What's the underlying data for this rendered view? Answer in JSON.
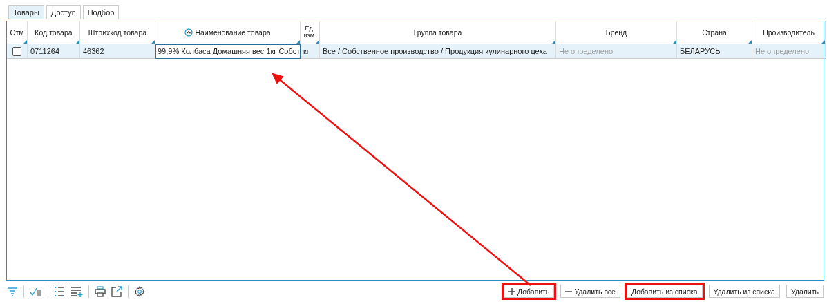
{
  "tabs": [
    {
      "label": "Товары",
      "selected": true
    },
    {
      "label": "Доступ",
      "selected": false
    },
    {
      "label": "Подбор",
      "selected": false
    }
  ],
  "table": {
    "columns": [
      {
        "label": "Отм",
        "sorted": false
      },
      {
        "label": "Код товара",
        "sorted": false
      },
      {
        "label": "Штрихкод товара",
        "sorted": false
      },
      {
        "label": "Наименование товара",
        "sorted": true
      },
      {
        "label": "Ед. изм.",
        "sorted": false
      },
      {
        "label": "Группа товара",
        "sorted": false
      },
      {
        "label": "Бренд",
        "sorted": false
      },
      {
        "label": "Страна",
        "sorted": false
      },
      {
        "label": "Производитель",
        "sorted": false
      }
    ],
    "rows": [
      {
        "cells": [
          {
            "kind": "checkbox",
            "checked": false
          },
          {
            "text": "0711264",
            "muted": false,
            "focused": false
          },
          {
            "text": "46362",
            "muted": false,
            "focused": false
          },
          {
            "text": "99,9% Колбаса Домашняя вес 1кг Собст",
            "muted": false,
            "focused": true
          },
          {
            "text": "кг",
            "muted": false,
            "focused": false
          },
          {
            "text": "Все / Собственное производство / Продукция кулинарного цеха",
            "muted": false,
            "focused": false
          },
          {
            "text": "Не определено",
            "muted": true,
            "focused": false
          },
          {
            "text": "БЕЛАРУСЬ",
            "muted": false,
            "focused": false
          },
          {
            "text": "Не определено",
            "muted": true,
            "focused": false
          }
        ]
      }
    ]
  },
  "buttons": [
    {
      "label": "Добавить",
      "kind": "add",
      "highlighted": true
    },
    {
      "label": "Удалить все",
      "kind": "remove",
      "highlighted": false
    },
    {
      "label": "Добавить из списка",
      "kind": "plain",
      "highlighted": true
    },
    {
      "label": "Удалить из списка",
      "kind": "plain",
      "highlighted": false
    },
    {
      "label": "Удалить",
      "kind": "plain",
      "highlighted": false
    }
  ]
}
